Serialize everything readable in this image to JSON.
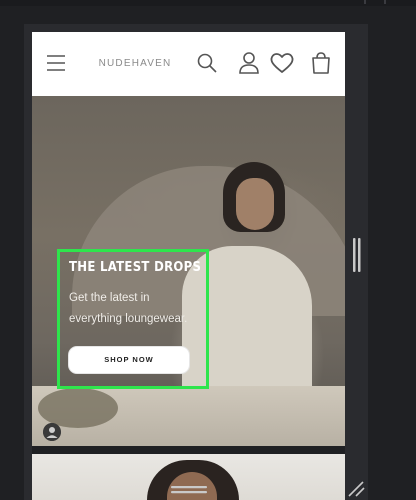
{
  "header": {
    "brand": "NUDEHAVEN",
    "icons": [
      "hamburger-menu-icon",
      "search-icon",
      "account-icon",
      "wishlist-heart-icon",
      "cart-bag-icon"
    ]
  },
  "hero": {
    "title": "THE LATEST DROPS",
    "description": "Get the latest in everything loungewear.",
    "cta_label": "SHOP NOW",
    "highlight_color": "#2ee54c"
  },
  "colors": {
    "background": "#1f2023",
    "header_bg": "#ffffff",
    "icon": "#555555"
  }
}
